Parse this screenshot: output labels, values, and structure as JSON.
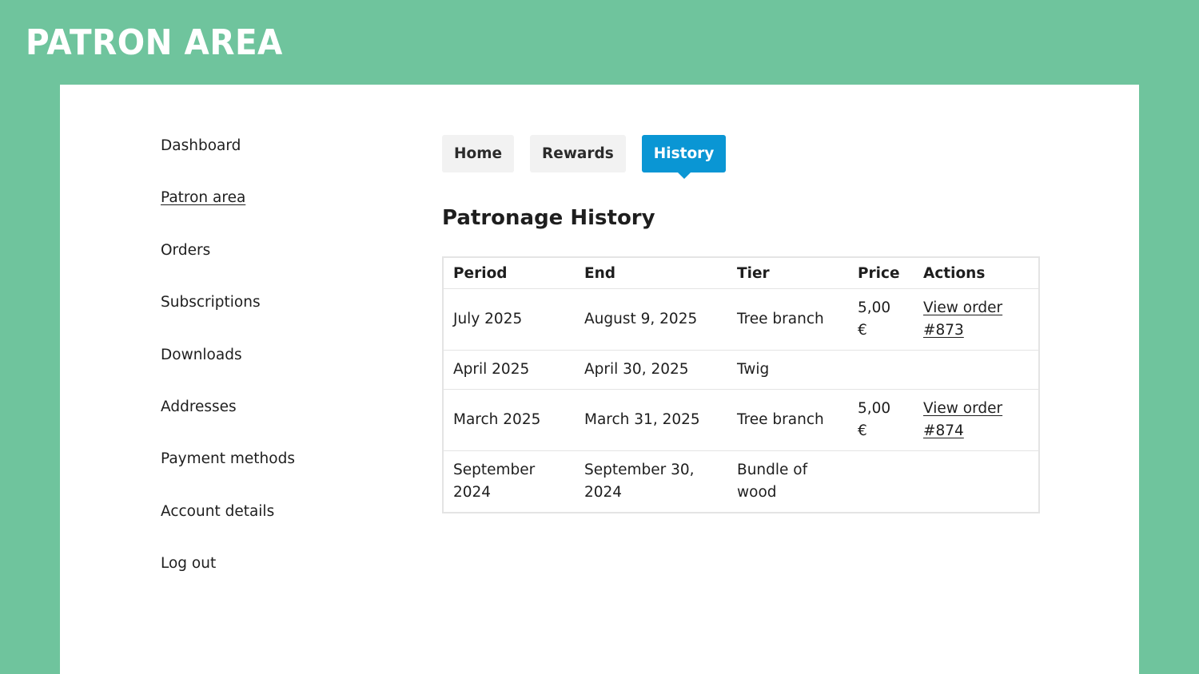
{
  "site": {
    "title": "Patron Area"
  },
  "sidebar": {
    "items": [
      {
        "label": "Dashboard"
      },
      {
        "label": "Patron area"
      },
      {
        "label": "Orders"
      },
      {
        "label": "Subscriptions"
      },
      {
        "label": "Downloads"
      },
      {
        "label": "Addresses"
      },
      {
        "label": "Payment methods"
      },
      {
        "label": "Account details"
      },
      {
        "label": "Log out"
      }
    ],
    "current": "Patron area"
  },
  "tabs": [
    {
      "label": "Home"
    },
    {
      "label": "Rewards"
    },
    {
      "label": "History"
    }
  ],
  "active_tab": "History",
  "history": {
    "title": "Patronage History",
    "columns": [
      "Period",
      "End",
      "Tier",
      "Price",
      "Actions"
    ],
    "rows": [
      {
        "period": "July 2025",
        "end": "August 9, 2025",
        "tier": "Tree branch",
        "price": "5,00 €",
        "action": "View order #873"
      },
      {
        "period": "April 2025",
        "end": "April 30, 2025",
        "tier": "Twig",
        "price": "",
        "action": ""
      },
      {
        "period": "March 2025",
        "end": "March 31, 2025",
        "tier": "Tree branch",
        "price": "5,00 €",
        "action": "View order #874"
      },
      {
        "period": "September 2024",
        "end": "September 30, 2024",
        "tier": "Bundle of wood",
        "price": "",
        "action": ""
      }
    ]
  },
  "colors": {
    "background": "#6fc49d",
    "panel": "#ffffff",
    "accent": "#0a96d4",
    "tab_inactive": "#f2f2f2",
    "border": "#e4e4e4"
  }
}
